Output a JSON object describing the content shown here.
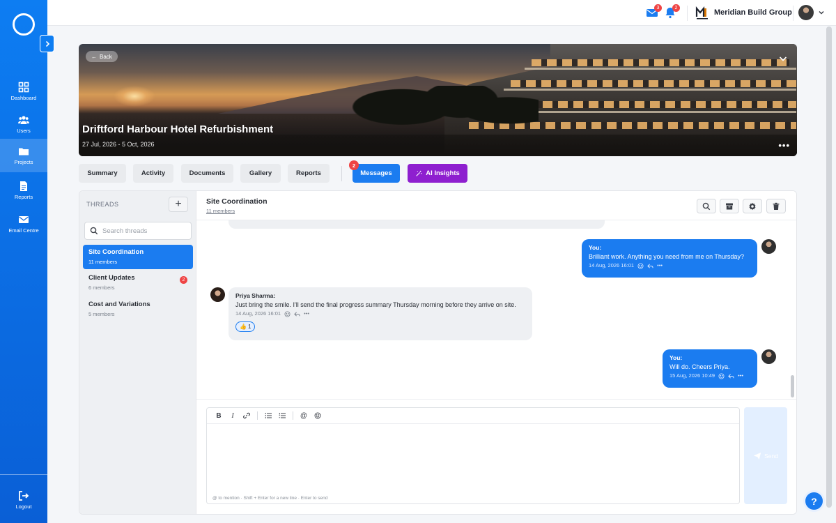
{
  "sidebar": {
    "items": [
      {
        "label": "Dashboard",
        "icon": "dashboard-icon"
      },
      {
        "label": "Users",
        "icon": "users-icon"
      },
      {
        "label": "Projects",
        "icon": "folder-icon"
      },
      {
        "label": "Reports",
        "icon": "report-icon"
      },
      {
        "label": "Email Centre",
        "icon": "mail-icon"
      }
    ],
    "active": "Projects",
    "logout_label": "Logout"
  },
  "topbar": {
    "mail_badge": "3",
    "bell_badge": "2",
    "company_name": "Meridian Build Group"
  },
  "project": {
    "back_label": "Back",
    "title": "Driftford Harbour Hotel Refurbishment",
    "dates": "27 Jul, 2026 - 5 Oct, 2026",
    "more_label": "•••"
  },
  "tabs": {
    "summary": "Summary",
    "activity": "Activity",
    "documents": "Documents",
    "gallery": "Gallery",
    "reports": "Reports",
    "messages": "Messages",
    "messages_badge": "2",
    "ai_insights": "AI Insights"
  },
  "threads": {
    "heading": "THREADS",
    "add_label": "+",
    "search_placeholder": "Search threads",
    "items": [
      {
        "name": "Site Coordination",
        "members": "11 members",
        "active": true
      },
      {
        "name": "Client Updates",
        "members": "6 members",
        "badge": "2"
      },
      {
        "name": "Cost and Variations",
        "members": "5 members"
      }
    ]
  },
  "chat": {
    "title": "Site Coordination",
    "members": "11 members",
    "messages": [
      {
        "author": "You:",
        "text": "Brilliant work. Anything you need from me on Thursday?",
        "time": "14 Aug, 2026 16:01"
      },
      {
        "author": "Priya Sharma:",
        "text": "Just bring the smile. I'll send the final progress summary Thursday morning before they arrive on site.",
        "time": "14 Aug, 2026 16:01",
        "reaction": "👍",
        "reaction_count": "1"
      },
      {
        "author": "You:",
        "text": "Will do. Cheers Priya.",
        "time": "15 Aug, 2026 10:49"
      }
    ],
    "meta_more": "•••"
  },
  "composer": {
    "hint": "@ to mention · Shift + Enter for a new line · Enter to send",
    "send_label": "Send"
  },
  "colors": {
    "primary": "#1b7cf0",
    "sidebar": "#0d7df2",
    "ai": "#8e1fcf",
    "badge": "#ef4444"
  }
}
